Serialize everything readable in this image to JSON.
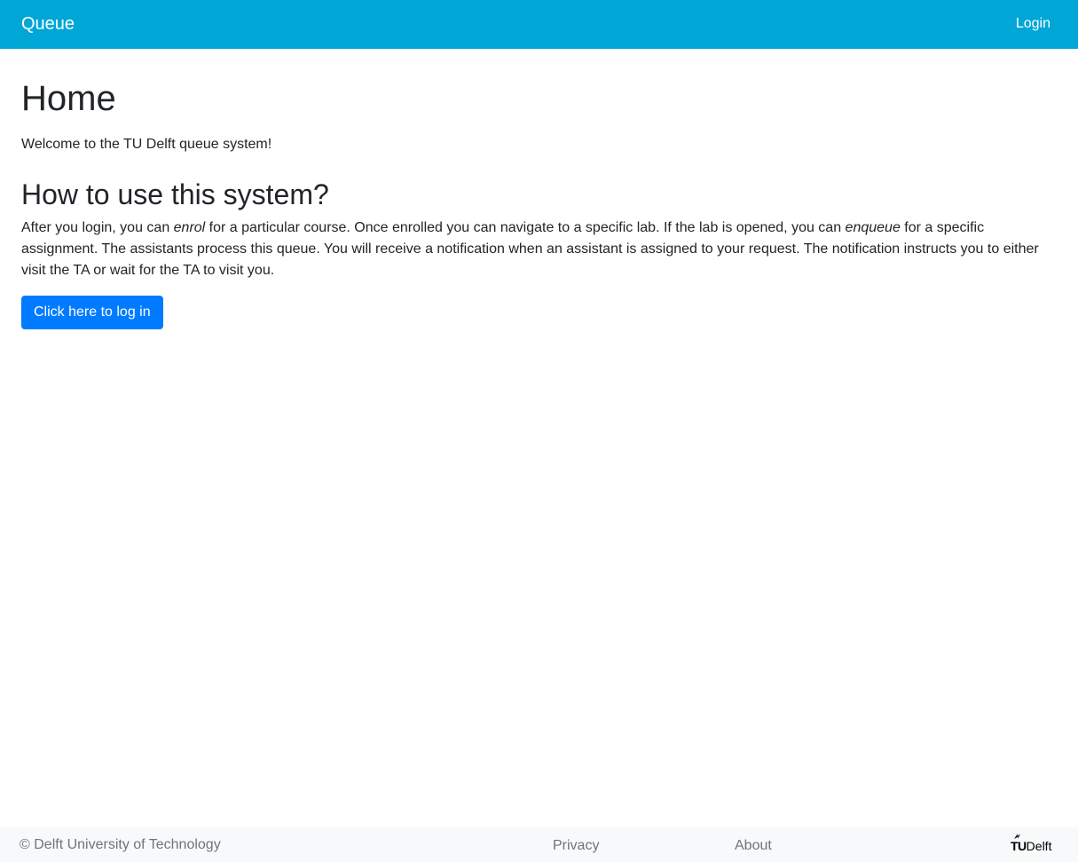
{
  "navbar": {
    "brand": "Queue",
    "login_label": "Login",
    "background_color": "#00a6d6"
  },
  "main": {
    "title": "Home",
    "welcome": "Welcome to the TU Delft queue system!",
    "how_to_title": "How to use this system?",
    "description": {
      "part1": "After you login, you can ",
      "em1": "enrol",
      "part2": " for a particular course. Once enrolled you can navigate to a specific lab. If the lab is opened, you can ",
      "em2": "enqueue",
      "part3": " for a specific assignment. The assistants process this queue. You will receive a notification when an assistant is assigned to your request. The notification instructs you to either visit the TA or wait for the TA to visit you."
    },
    "login_button_label": "Click here to log in",
    "button_color": "#007bff"
  },
  "footer": {
    "copyright": "© Delft University of Technology",
    "privacy_label": "Privacy",
    "about_label": "About",
    "logo": {
      "icon": "tu-delft-flame-icon",
      "tu": "TU",
      "delft": "Delft"
    }
  }
}
